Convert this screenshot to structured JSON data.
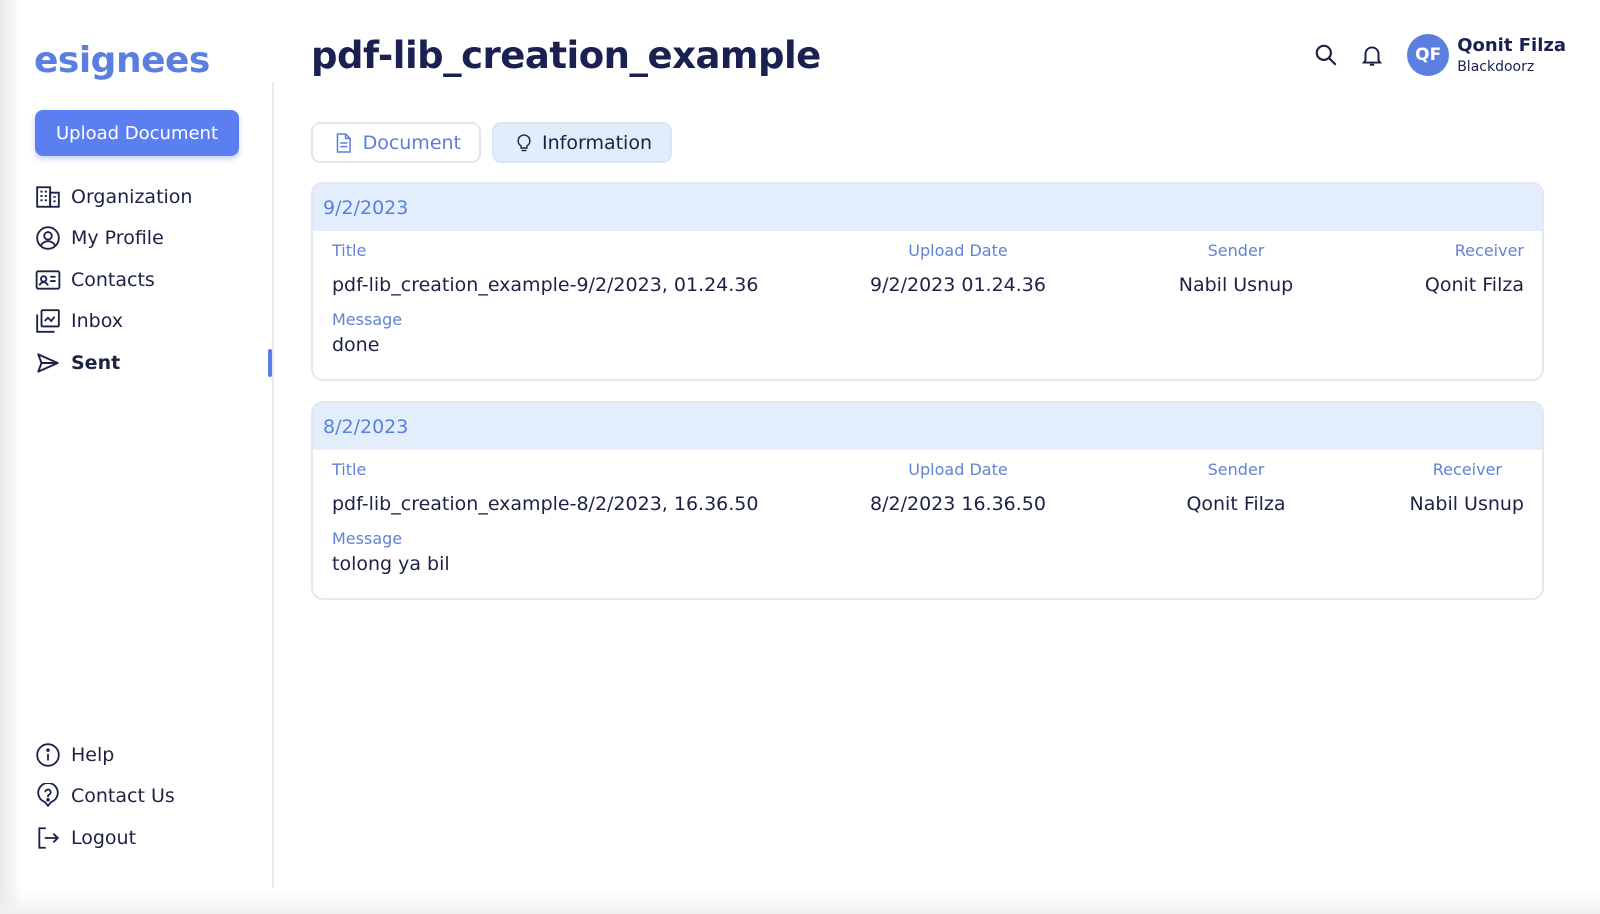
{
  "app": {
    "logo": "esignees"
  },
  "sidebar": {
    "upload_label": "Upload Document",
    "items": [
      {
        "label": "Organization",
        "icon": "building-icon"
      },
      {
        "label": "My Profile",
        "icon": "user-circle-icon"
      },
      {
        "label": "Contacts",
        "icon": "contact-card-icon"
      },
      {
        "label": "Inbox",
        "icon": "inbox-icon"
      },
      {
        "label": "Sent",
        "icon": "send-icon",
        "active": true
      }
    ],
    "bottom_items": [
      {
        "label": "Help",
        "icon": "info-icon"
      },
      {
        "label": "Contact Us",
        "icon": "question-bubble-icon"
      },
      {
        "label": "Logout",
        "icon": "logout-icon"
      }
    ]
  },
  "header": {
    "title": "pdf-lib_creation_example",
    "user": {
      "initials": "QF",
      "name": "Qonit Filza",
      "org": "Blackdoorz"
    }
  },
  "tabs": [
    {
      "label": "Document",
      "icon": "document-icon"
    },
    {
      "label": "Information",
      "icon": "lightbulb-icon",
      "active": true
    }
  ],
  "columns": {
    "title": "Title",
    "upload_date": "Upload Date",
    "sender": "Sender",
    "receiver": "Receiver",
    "message": "Message"
  },
  "records": [
    {
      "date": "9/2/2023",
      "title": "pdf-lib_creation_example-9/2/2023, 01.24.36",
      "upload_date": "9/2/2023 01.24.36",
      "sender": "Nabil Usnup",
      "receiver": "Qonit Filza",
      "message": "done"
    },
    {
      "date": "8/2/2023",
      "title": "pdf-lib_creation_example-8/2/2023, 16.36.50",
      "upload_date": "8/2/2023 16.36.50",
      "sender": "Qonit Filza",
      "receiver": "Nabil Usnup",
      "message": "tolong ya bil"
    }
  ],
  "colors": {
    "accent": "#5b7ff0",
    "header_bg": "#e2eefb",
    "text": "#1d2245"
  }
}
